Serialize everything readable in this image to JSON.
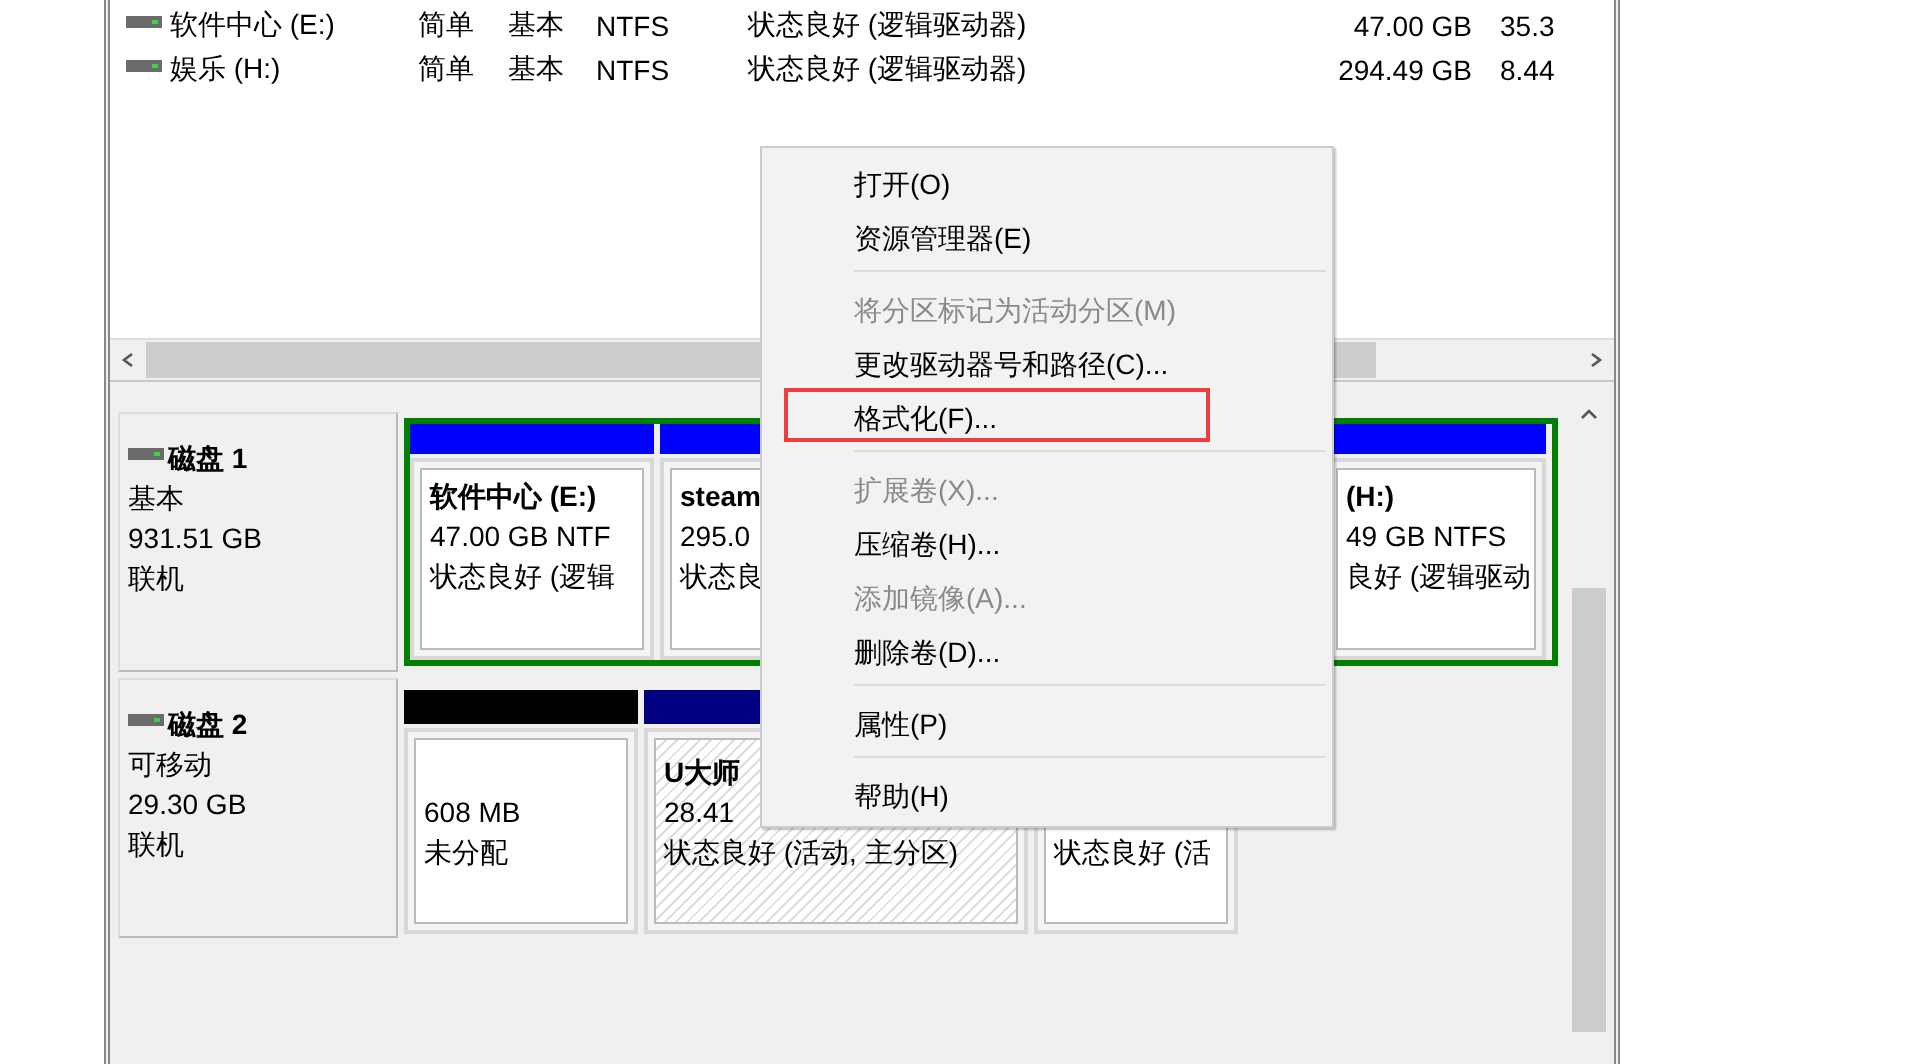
{
  "volumes": [
    {
      "name": "软件中心 (E:)",
      "layout": "简单",
      "type": "基本",
      "fs": "NTFS",
      "status": "状态良好 (逻辑驱动器)",
      "capacity": "47.00 GB",
      "free": "35.3"
    },
    {
      "name": "娱乐 (H:)",
      "layout": "简单",
      "type": "基本",
      "fs": "NTFS",
      "status": "状态良好 (逻辑驱动器)",
      "capacity": "294.49 GB",
      "free": "8.44"
    }
  ],
  "disks": [
    {
      "name": "磁盘 1",
      "type": "基本",
      "size": "931.51 GB",
      "state": "联机",
      "extended": true,
      "partitions": [
        {
          "title": "软件中心  (E:)",
          "size": "47.00 GB NTF",
          "status": "状态良好 (逻辑",
          "color": "#0000ff",
          "selected": false
        },
        {
          "title": "steam",
          "size": "295.0",
          "status": "状态良",
          "color": "#0000ff",
          "selected": false
        },
        {
          "title": "(H:)",
          "size": "49 GB NTFS",
          "status": "良好 (逻辑驱动",
          "color": "#0000ff",
          "selected": false
        }
      ]
    },
    {
      "name": "磁盘 2",
      "type": "可移动",
      "size": "29.30 GB",
      "state": "联机",
      "extended": false,
      "partitions": [
        {
          "size": "608 MB",
          "status": "未分配",
          "color": "#000000",
          "selected": false
        },
        {
          "title": "U大师",
          "size": "28.41",
          "status": "状态良好 (活动, 主分区)",
          "color": "#000080",
          "selected": true
        },
        {
          "status": "状态良好 (活",
          "selected": false
        }
      ]
    }
  ],
  "context_menu": {
    "groups": [
      [
        {
          "label": "打开(O)",
          "disabled": false,
          "highlighted": false
        },
        {
          "label": "资源管理器(E)",
          "disabled": false,
          "highlighted": false
        }
      ],
      [
        {
          "label": "将分区标记为活动分区(M)",
          "disabled": true,
          "highlighted": false
        },
        {
          "label": "更改驱动器号和路径(C)...",
          "disabled": false,
          "highlighted": false
        },
        {
          "label": "格式化(F)...",
          "disabled": false,
          "highlighted": true
        }
      ],
      [
        {
          "label": "扩展卷(X)...",
          "disabled": true,
          "highlighted": false
        },
        {
          "label": "压缩卷(H)...",
          "disabled": false,
          "highlighted": false
        },
        {
          "label": "添加镜像(A)...",
          "disabled": true,
          "highlighted": false
        },
        {
          "label": "删除卷(D)...",
          "disabled": false,
          "highlighted": false
        }
      ],
      [
        {
          "label": "属性(P)",
          "disabled": false,
          "highlighted": false
        }
      ],
      [
        {
          "label": "帮助(H)",
          "disabled": false,
          "highlighted": false
        }
      ]
    ]
  }
}
